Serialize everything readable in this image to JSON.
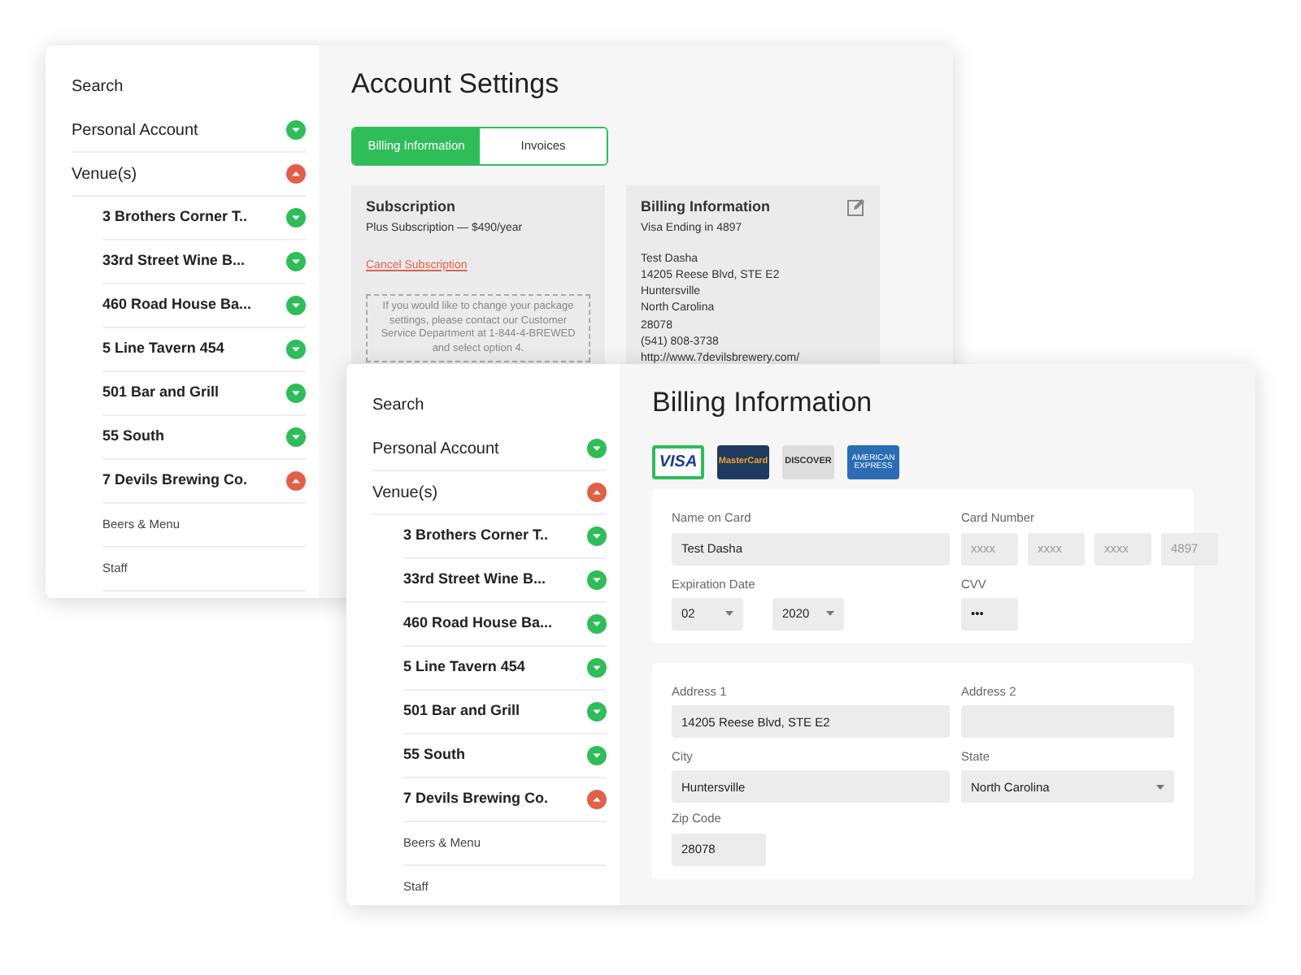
{
  "windows": [
    {
      "kind": "account",
      "sidebar": {
        "search": "Search",
        "items": [
          {
            "label": "Personal Account",
            "expanded": false
          },
          {
            "label": "Venue(s)",
            "expanded": true,
            "children": [
              {
                "label": "3 Brothers Corner T..",
                "expanded": false
              },
              {
                "label": "33rd Street Wine B...",
                "expanded": false
              },
              {
                "label": "460 Road House Ba...",
                "expanded": false
              },
              {
                "label": "5 Line Tavern 454",
                "expanded": false
              },
              {
                "label": "501 Bar and Grill",
                "expanded": false
              },
              {
                "label": "55 South",
                "expanded": false
              },
              {
                "label": "7 Devils Brewing Co.",
                "expanded": true,
                "children": [
                  {
                    "label": "Beers & Menu"
                  },
                  {
                    "label": "Staff"
                  }
                ]
              }
            ]
          }
        ]
      },
      "title": "Account Settings",
      "tabs": [
        {
          "label": "Billing Information",
          "selected": true
        },
        {
          "label": "Invoices",
          "selected": false
        }
      ],
      "subscription": {
        "title": "Subscription",
        "plan": "Plus Subscription — $490/year",
        "cancel_link": "Cancel Subscription",
        "note": "If you would like to change your package settings, please contact our Customer Service Department at 1-844-4-BREWED and select option 4."
      },
      "billing_summary": {
        "title": "Billing Information",
        "card": "Visa Ending in 4897",
        "lines": [
          "Test Dasha",
          "14205 Reese Blvd, STE E2",
          "Huntersville",
          "North Carolina",
          "28078",
          "(541) 808-3738",
          "http://www.7devilsbrewery.com/"
        ]
      }
    },
    {
      "kind": "billing",
      "sidebar": {
        "search": "Search",
        "items": [
          {
            "label": "Personal Account",
            "expanded": false
          },
          {
            "label": "Venue(s)",
            "expanded": true,
            "children": [
              {
                "label": "3 Brothers Corner T..",
                "expanded": false
              },
              {
                "label": "33rd Street Wine B...",
                "expanded": false
              },
              {
                "label": "460 Road House Ba...",
                "expanded": false
              },
              {
                "label": "5 Line Tavern 454",
                "expanded": false
              },
              {
                "label": "501 Bar and Grill",
                "expanded": false
              },
              {
                "label": "55 South",
                "expanded": false
              },
              {
                "label": "7 Devils Brewing Co.",
                "expanded": true,
                "children": [
                  {
                    "label": "Beers & Menu"
                  },
                  {
                    "label": "Staff"
                  }
                ]
              }
            ]
          }
        ]
      },
      "title": "Billing Information",
      "card_types": [
        {
          "kind": "visa",
          "label": "VISA",
          "selected": true
        },
        {
          "kind": "mastercard",
          "label": "MasterCard",
          "selected": false
        },
        {
          "kind": "discover",
          "label": "DISCOVER",
          "selected": false
        },
        {
          "kind": "amex",
          "label": "AMERICAN EXPRESS",
          "selected": false
        }
      ],
      "card_form": {
        "name_label": "Name on Card",
        "name_value": "Test Dasha",
        "number_label": "Card Number",
        "number_parts": [
          {
            "placeholder": "xxxx"
          },
          {
            "placeholder": "xxxx"
          },
          {
            "placeholder": "xxxx"
          },
          {
            "placeholder": "4897"
          }
        ],
        "expiration_label": "Expiration Date",
        "month": "02",
        "year": "2020",
        "cvv_label": "CVV",
        "cvv_value": "•••"
      },
      "address_form": {
        "address1_label": "Address 1",
        "address1_value": "14205 Reese Blvd, STE E2",
        "address2_label": "Address 2",
        "city_label": "City",
        "city_value": "Huntersville",
        "state_label": "State",
        "state_value": "North Carolina",
        "zip_label": "Zip Code",
        "zip_value": "28078"
      }
    }
  ]
}
